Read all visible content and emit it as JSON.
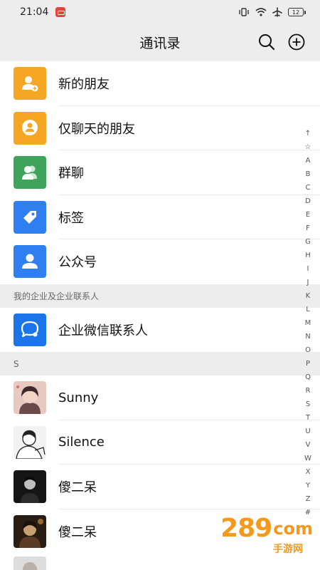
{
  "status_bar": {
    "time": "21:04",
    "battery": "12"
  },
  "header": {
    "title": "通讯录"
  },
  "fixed_items": [
    {
      "label": "新的朋友",
      "icon": "new-friend-icon",
      "color": "#f5a623"
    },
    {
      "label": "仅聊天的朋友",
      "icon": "chat-only-friend-icon",
      "color": "#f5a623"
    },
    {
      "label": "群聊",
      "icon": "group-chat-icon",
      "color": "#3fa35c"
    },
    {
      "label": "标签",
      "icon": "tag-icon",
      "color": "#2f7ff0"
    },
    {
      "label": "公众号",
      "icon": "official-account-icon",
      "color": "#2f7ff0"
    }
  ],
  "enterprise_section": {
    "header": "我的企业及企业联系人",
    "item_label": "企业微信联系人",
    "icon": "enterprise-wechat-icon",
    "color": "#1b74e8"
  },
  "contact_section": {
    "header": "S"
  },
  "contacts": [
    {
      "name": "Sunny"
    },
    {
      "name": "Silence"
    },
    {
      "name": "傻二呆"
    },
    {
      "name": "傻二呆"
    }
  ],
  "index_letters": [
    "↑",
    "☆",
    "A",
    "B",
    "C",
    "D",
    "E",
    "F",
    "G",
    "H",
    "I",
    "J",
    "K",
    "L",
    "M",
    "N",
    "O",
    "P",
    "Q",
    "R",
    "S",
    "T",
    "U",
    "V",
    "W",
    "X",
    "Y",
    "Z",
    "#"
  ],
  "watermark": {
    "main": "289",
    "suffix": "com",
    "sub": "手游网"
  }
}
